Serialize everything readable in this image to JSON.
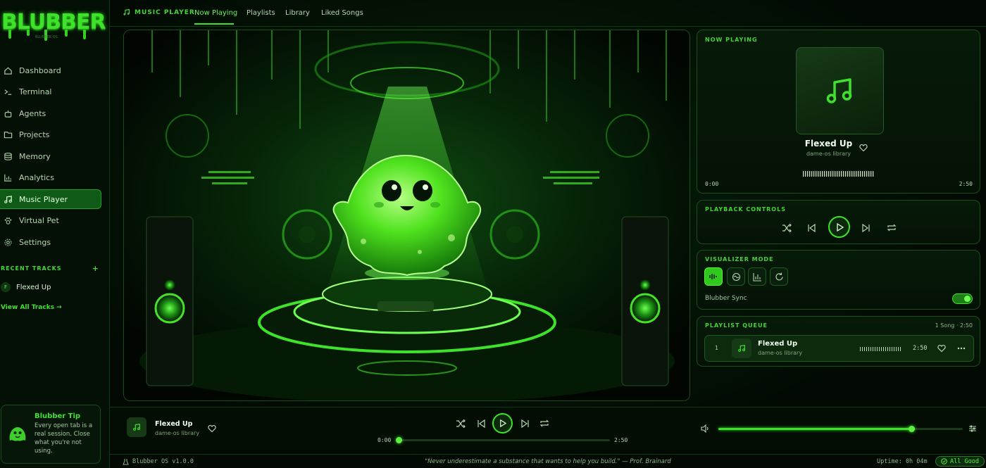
{
  "app": {
    "logo": "BLUBBER",
    "logo_sub": "BLUBBER OS"
  },
  "sidebar": {
    "items": [
      {
        "label": "Dashboard",
        "icon": "home-icon"
      },
      {
        "label": "Terminal",
        "icon": "terminal-icon"
      },
      {
        "label": "Agents",
        "icon": "robot-icon"
      },
      {
        "label": "Projects",
        "icon": "folder-icon"
      },
      {
        "label": "Memory",
        "icon": "database-icon"
      },
      {
        "label": "Analytics",
        "icon": "chart-icon"
      },
      {
        "label": "Music Player",
        "icon": "music-icon",
        "active": true
      },
      {
        "label": "Virtual Pet",
        "icon": "paw-icon"
      },
      {
        "label": "Settings",
        "icon": "gear-icon"
      }
    ],
    "recent_header": "RECENT TRACKS",
    "recent_add": "+",
    "recent_tracks": [
      {
        "badge": "F",
        "title": "Flexed Up"
      }
    ],
    "view_all": "View All Tracks →",
    "tip": {
      "title": "Blubber Tip",
      "body": "Every open tab is a real session. Close what you're not using."
    }
  },
  "topnav": {
    "brand": "MUSIC PLAYER",
    "tabs": [
      "Now Playing",
      "Playlists",
      "Library",
      "Liked Songs"
    ],
    "active_tab": "Now Playing"
  },
  "now_playing": {
    "header": "NOW PLAYING",
    "title": "Flexed Up",
    "artist": "dame-os library",
    "time_current": "0:00",
    "time_total": "2:50"
  },
  "playback": {
    "header": "PLAYBACK CONTROLS",
    "buttons": [
      "shuffle-icon",
      "previous-icon",
      "play-icon",
      "next-icon",
      "repeat-icon"
    ]
  },
  "visualizer": {
    "header": "VISUALIZER MODE",
    "modes": [
      "waveform-icon",
      "circle-wave-icon",
      "bars-icon",
      "refresh-icon"
    ],
    "active_mode": 0,
    "sync_label": "Blubber Sync",
    "sync_on": true
  },
  "queue": {
    "header": "PLAYLIST QUEUE",
    "count": "1 Song",
    "count_total": "2:50",
    "items": [
      {
        "index": "1",
        "title": "Flexed Up",
        "artist": "dame-os library",
        "duration": "2:50"
      }
    ]
  },
  "bottom_player": {
    "title": "Flexed Up",
    "artist": "dame-os library",
    "time_current": "0:00",
    "time_total": "2:50",
    "progress": 0.0,
    "volume": 0.79
  },
  "status": {
    "version": "Blubber OS v1.0.0",
    "quote": "\"Never underestimate a substance that wants to help you build.\" — Prof. Brainard",
    "uptime": "Uptime: 0h 04m",
    "health": "All Good"
  },
  "colors": {
    "accent": "#3fe22a",
    "bg": "#020a03",
    "panel": "#071a08",
    "border": "#1c4d1d"
  }
}
